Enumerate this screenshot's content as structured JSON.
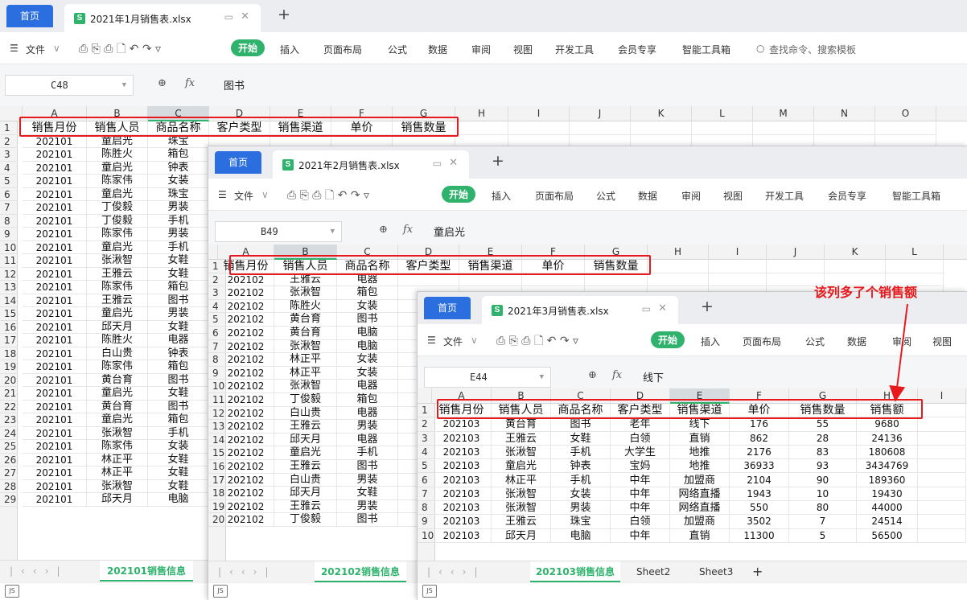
{
  "annotation": "该列多了个销售额",
  "common": {
    "home_tab": "首页",
    "menu": [
      "文件",
      "开始",
      "插入",
      "页面布局",
      "公式",
      "数据",
      "审阅",
      "视图",
      "开发工具",
      "会员专享",
      "智能工具箱"
    ],
    "search_placeholder": "查找命令、搜索模板",
    "fx": "fx"
  },
  "win1": {
    "filename": "2021年1月销售表.xlsx",
    "cell_ref": "C48",
    "formula_value": "图书",
    "columns": [
      "A",
      "B",
      "C",
      "D",
      "E",
      "F",
      "G",
      "H",
      "I",
      "J",
      "K",
      "L",
      "M",
      "N",
      "O"
    ],
    "headers": [
      "销售月份",
      "销售人员",
      "商品名称",
      "客户类型",
      "销售渠道",
      "单价",
      "销售数量"
    ],
    "rows": [
      [
        "202101",
        "童启光",
        "珠宝"
      ],
      [
        "202101",
        "陈胜火",
        "箱包"
      ],
      [
        "202101",
        "童启光",
        "钟表"
      ],
      [
        "202101",
        "陈家伟",
        "女装"
      ],
      [
        "202101",
        "童启光",
        "珠宝"
      ],
      [
        "202101",
        "丁俊毅",
        "男装"
      ],
      [
        "202101",
        "丁俊毅",
        "手机"
      ],
      [
        "202101",
        "陈家伟",
        "男装"
      ],
      [
        "202101",
        "童启光",
        "手机"
      ],
      [
        "202101",
        "张湫智",
        "女鞋"
      ],
      [
        "202101",
        "王雅云",
        "女鞋"
      ],
      [
        "202101",
        "陈家伟",
        "箱包"
      ],
      [
        "202101",
        "王雅云",
        "图书"
      ],
      [
        "202101",
        "童启光",
        "男装"
      ],
      [
        "202101",
        "邱天月",
        "女鞋"
      ],
      [
        "202101",
        "陈胜火",
        "电器"
      ],
      [
        "202101",
        "白山贵",
        "钟表"
      ],
      [
        "202101",
        "陈家伟",
        "箱包"
      ],
      [
        "202101",
        "黄台育",
        "图书"
      ],
      [
        "202101",
        "童启光",
        "女鞋"
      ],
      [
        "202101",
        "黄台育",
        "图书"
      ],
      [
        "202101",
        "童启光",
        "箱包"
      ],
      [
        "202101",
        "张湫智",
        "手机"
      ],
      [
        "202101",
        "陈家伟",
        "女装"
      ],
      [
        "202101",
        "林正平",
        "女鞋"
      ],
      [
        "202101",
        "林正平",
        "女鞋"
      ],
      [
        "202101",
        "张湫智",
        "女鞋"
      ],
      [
        "202101",
        "邱天月",
        "电脑"
      ]
    ],
    "sheet_tab": "202101销售信息"
  },
  "win2": {
    "filename": "2021年2月销售表.xlsx",
    "cell_ref": "B49",
    "formula_value": "童启光",
    "columns": [
      "A",
      "B",
      "C",
      "D",
      "E",
      "F",
      "G",
      "H",
      "I",
      "J",
      "K",
      "L"
    ],
    "headers": [
      "销售月份",
      "销售人员",
      "商品名称",
      "客户类型",
      "销售渠道",
      "单价",
      "销售数量"
    ],
    "rows": [
      [
        "202102",
        "王雅云",
        "电器"
      ],
      [
        "202102",
        "张湫智",
        "箱包"
      ],
      [
        "202102",
        "陈胜火",
        "女装"
      ],
      [
        "202102",
        "黄台育",
        "图书"
      ],
      [
        "202102",
        "黄台育",
        "电脑"
      ],
      [
        "202102",
        "张湫智",
        "电脑"
      ],
      [
        "202102",
        "林正平",
        "女装"
      ],
      [
        "202102",
        "林正平",
        "女装"
      ],
      [
        "202102",
        "张湫智",
        "电器"
      ],
      [
        "202102",
        "丁俊毅",
        "箱包"
      ],
      [
        "202102",
        "白山贵",
        "电器"
      ],
      [
        "202102",
        "王雅云",
        "男装"
      ],
      [
        "202102",
        "邱天月",
        "电器"
      ],
      [
        "202102",
        "童启光",
        "手机"
      ],
      [
        "202102",
        "王雅云",
        "图书"
      ],
      [
        "202102",
        "白山贵",
        "男装"
      ],
      [
        "202102",
        "邱天月",
        "女鞋"
      ],
      [
        "202102",
        "王雅云",
        "男装"
      ],
      [
        "202102",
        "丁俊毅",
        "图书"
      ]
    ],
    "sheet_tab": "202102销售信息"
  },
  "win3": {
    "filename": "2021年3月销售表.xlsx",
    "cell_ref": "E44",
    "formula_value": "线下",
    "columns": [
      "A",
      "B",
      "C",
      "D",
      "E",
      "F",
      "G",
      "H",
      "I"
    ],
    "headers": [
      "销售月份",
      "销售人员",
      "商品名称",
      "客户类型",
      "销售渠道",
      "单价",
      "销售数量",
      "销售额"
    ],
    "rows": [
      [
        "202103",
        "黄台育",
        "图书",
        "老年",
        "线下",
        "176",
        "55",
        "9680"
      ],
      [
        "202103",
        "王雅云",
        "女鞋",
        "白领",
        "直销",
        "862",
        "28",
        "24136"
      ],
      [
        "202103",
        "张湫智",
        "手机",
        "大学生",
        "地推",
        "2176",
        "83",
        "180608"
      ],
      [
        "202103",
        "童启光",
        "钟表",
        "宝妈",
        "地推",
        "36933",
        "93",
        "3434769"
      ],
      [
        "202103",
        "林正平",
        "手机",
        "中年",
        "加盟商",
        "2104",
        "90",
        "189360"
      ],
      [
        "202103",
        "张湫智",
        "女装",
        "中年",
        "网络直播",
        "1943",
        "10",
        "19430"
      ],
      [
        "202103",
        "张湫智",
        "男装",
        "中年",
        "网络直播",
        "550",
        "80",
        "44000"
      ],
      [
        "202103",
        "王雅云",
        "珠宝",
        "白领",
        "加盟商",
        "3502",
        "7",
        "24514"
      ],
      [
        "202103",
        "邱天月",
        "电脑",
        "中年",
        "直销",
        "11300",
        "5",
        "56500"
      ]
    ],
    "sheet_tab": "202103销售信息",
    "other_sheets": [
      "Sheet2",
      "Sheet3"
    ]
  }
}
